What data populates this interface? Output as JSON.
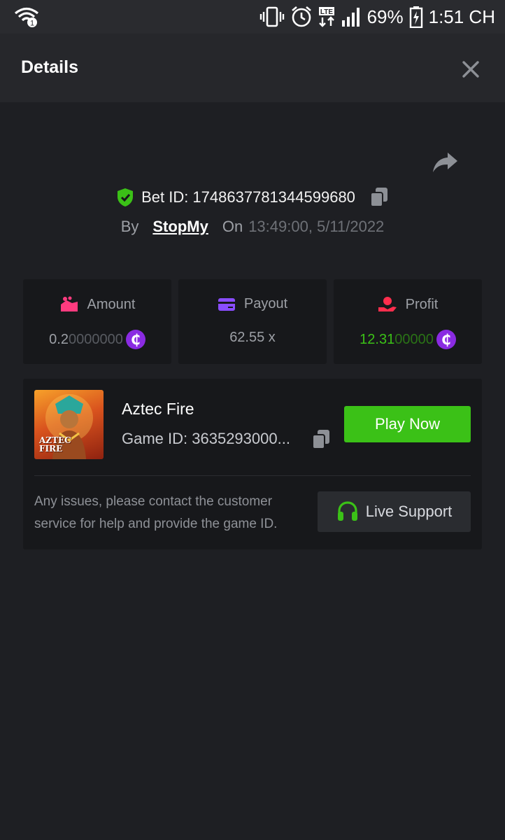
{
  "status_bar": {
    "battery": "69%",
    "time": "1:51 CH",
    "network": "LTE"
  },
  "header": {
    "title": "Details"
  },
  "bet": {
    "id_label": "Bet ID: 1748637781344599680",
    "by_label": "By",
    "user": "StopMy",
    "on_label": "On",
    "datetime": "13:49:00, 5/11/2022"
  },
  "stats": {
    "amount": {
      "label": "Amount",
      "value_main": "0.2",
      "value_dim": "0000000"
    },
    "payout": {
      "label": "Payout",
      "value": "62.55 x"
    },
    "profit": {
      "label": "Profit",
      "value_main": "12.31",
      "value_dim": "00000"
    }
  },
  "game": {
    "name": "Aztec Fire",
    "id_label": "Game ID: 3635293000...",
    "play_label": "Play Now",
    "thumb_title_1": "AZTEC",
    "thumb_title_2": "FIRE",
    "notice": "Any issues, please contact the customer service for help and provide the game ID.",
    "support_label": "Live Support"
  },
  "colors": {
    "accent_green": "#3bc117",
    "coin_purple": "#8a2be2",
    "amount_icon": "#ff3b7f",
    "payout_icon": "#8a4dff",
    "profit_icon": "#ff2e4d"
  },
  "icons": {
    "wifi": "wifi-icon",
    "vibrate": "vibrate-icon",
    "alarm": "alarm-icon",
    "signal": "signal-icon",
    "battery": "battery-icon",
    "close": "close-icon",
    "share": "share-icon",
    "shield": "shield-check-icon",
    "copy": "copy-icon",
    "coin": "coin-icon",
    "headset": "headset-icon"
  }
}
